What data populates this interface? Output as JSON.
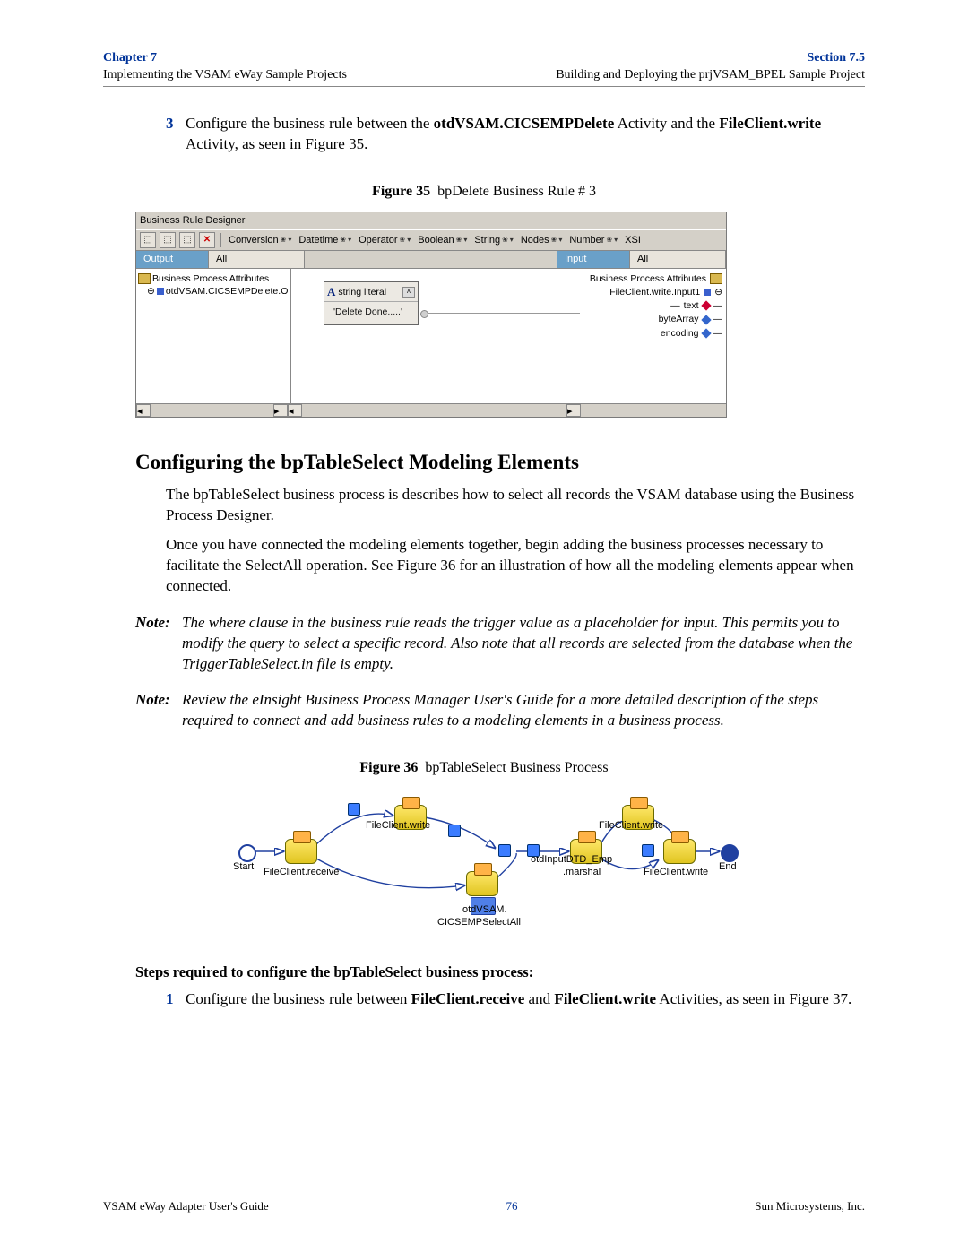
{
  "header": {
    "left_top": "Chapter 7",
    "left_bottom": "Implementing the VSAM eWay Sample Projects",
    "right_top": "Section 7.5",
    "right_bottom": "Building and Deploying the prjVSAM_BPEL Sample Project"
  },
  "step3": {
    "num": "3",
    "pre": "Configure the business rule between the ",
    "b1": "otdVSAM.CICSEMPDelete",
    "mid1": " Activity and the ",
    "b2": "FileClient.write",
    "post": " Activity, as seen in Figure 35."
  },
  "fig35": {
    "caption_label": "Figure 35",
    "caption_text": "bpDelete Business Rule # 3",
    "window_title": "Business Rule Designer",
    "toolbar": {
      "items": [
        "Conversion",
        "Datetime",
        "Operator",
        "Boolean",
        "String",
        "Nodes",
        "Number",
        "XSI"
      ]
    },
    "left_header": "Output",
    "left_all": "All",
    "right_header": "Input",
    "right_all": "All",
    "left_tree_root": "Business Process Attributes",
    "left_tree_child": "otdVSAM.CICSEMPDelete.O",
    "mapbox_title": "string literal",
    "mapbox_value": "'Delete Done.....'",
    "right_attr_root": "Business Process Attributes",
    "right_attr1": "FileClient.write.Input1",
    "right_attr2": "text",
    "right_attr3": "byteArray",
    "right_attr4": "encoding"
  },
  "section_heading": "Configuring the bpTableSelect Modeling Elements",
  "para1": "The bpTableSelect business process is describes how to select all records the VSAM database using the Business Process Designer.",
  "para2": "Once you have connected the modeling elements together, begin adding the business processes necessary to facilitate the SelectAll operation. See Figure 36 for an illustration of how all the modeling elements appear when connected.",
  "note1": {
    "label": "Note:",
    "text": "The where clause in the business rule reads the trigger value as a placeholder for input. This permits you to modify the query to select a specific record. Also note that all records are selected from the database when the TriggerTableSelect.in file is empty."
  },
  "note2": {
    "label": "Note:",
    "text": "Review the eInsight Business Process Manager User's Guide for a more detailed description of the steps required to connect and add business rules to a modeling elements in a business process."
  },
  "fig36": {
    "caption_label": "Figure 36",
    "caption_text": "bpTableSelect Business Process",
    "labels": {
      "start": "Start",
      "receive": "FileClient.receive",
      "write_top_left": "FileClient.write",
      "otdvsam1": "otdVSAM.",
      "otdvsam2": "CICSEMPSelectAll",
      "dtd1": "otdInputDTD_Emp",
      "dtd2": ".marshal",
      "write_top_right": "FileClient.write",
      "write_bottom": "FileClient.write",
      "end": "End"
    }
  },
  "steps_header": "Steps required to configure the bpTableSelect business process:",
  "step1": {
    "num": "1",
    "pre": "Configure the business rule between ",
    "b1": "FileClient.receive",
    "mid": " and ",
    "b2": "FileClient.write",
    "post": " Activities, as seen in Figure 37."
  },
  "footer": {
    "left": "VSAM eWay Adapter User's Guide",
    "page": "76",
    "right": "Sun Microsystems, Inc."
  }
}
